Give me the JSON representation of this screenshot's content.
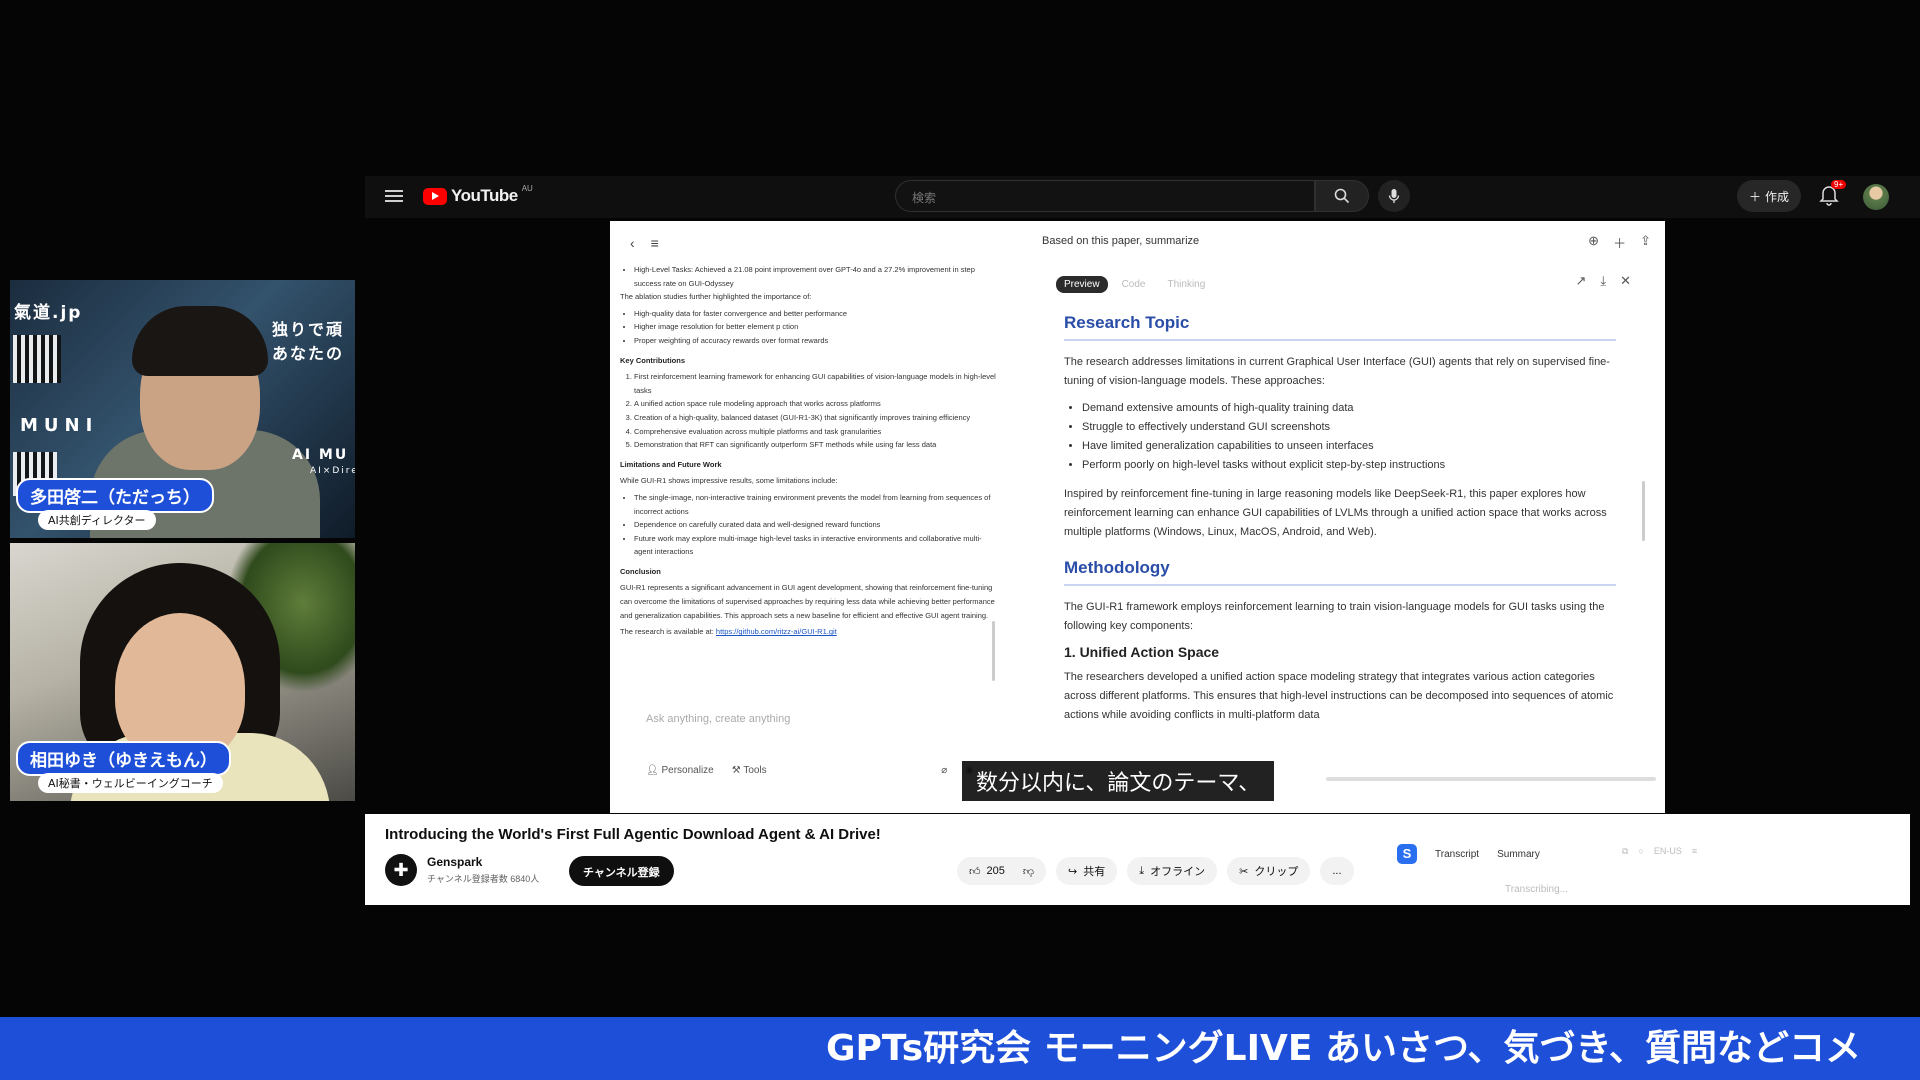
{
  "youtube": {
    "logo_text": "YouTube",
    "region": "AU",
    "search_placeholder": "検索",
    "create_label": "作成",
    "notification_badge": "9+"
  },
  "cams": [
    {
      "name": "多田啓二（ただっち）",
      "role": "AI共創ディレクター",
      "overlay_texts": [
        "氣道.jp",
        "独りで頑",
        "あなたの",
        "MUNI",
        "AI MU",
        "AI×Direct"
      ]
    },
    {
      "name": "相田ゆき（ゆきえもん）",
      "role": "AI秘書・ウェルビーイングコーチ"
    }
  ],
  "left_pane": {
    "intro_items": [
      "High-Level Tasks: Achieved a 21.08 point improvement over GPT-4o and a 27.2% improvement in step success rate on GUI-Odyssey"
    ],
    "ablation_intro": "The ablation studies further highlighted the importance of:",
    "ablation_items": [
      "High-quality data for faster convergence and better performance",
      "Higher image resolution for better element p   ction",
      "Proper weighting of accuracy rewards over format rewards"
    ],
    "contrib_heading": "Key Contributions",
    "contrib_items": [
      "First reinforcement learning framework for enhancing GUI capabilities of vision-language models in high-level tasks",
      "A unified action space rule modeling approach that works across platforms",
      "Creation of a high-quality, balanced dataset (GUI-R1-3K) that significantly improves training efficiency",
      "Comprehensive evaluation across multiple platforms and task granularities",
      "Demonstration that RFT can significantly outperform SFT methods while using far less data"
    ],
    "limits_heading": "Limitations and Future Work",
    "limits_intro": "While GUI-R1 shows impressive results, some limitations include:",
    "limits_items": [
      "The single-image, non-interactive training environment prevents the model from learning from sequences of incorrect actions",
      "Dependence on carefully curated data and well-designed reward functions",
      "Future work may explore multi-image high-level tasks in interactive environments and collaborative multi-agent interactions"
    ],
    "conclusion_heading": "Conclusion",
    "conclusion_text": "GUI-R1 represents a significant advancement in GUI agent development, showing that reinforcement fine-tuning can overcome the limitations of supervised approaches by requiring less data while achieving better performance and generalization capabilities. This approach sets a new baseline for efficient and effective GUI agent training.",
    "available_text": "The research is available at:",
    "link_text": "https://github.com/ritzz-ai/GUI-R1.git",
    "ask_placeholder": "Ask anything, create anything",
    "personalize_label": "Personalize",
    "tools_label": "Tools"
  },
  "right_pane": {
    "header_title": "Based on this paper, summarize",
    "tabs": [
      {
        "label": "Preview",
        "active": true
      },
      {
        "label": "Code",
        "active": false
      },
      {
        "label": "Thinking",
        "active": false
      }
    ],
    "section1_title": "Research Topic",
    "section1_p1": "The research addresses limitations in current Graphical User Interface (GUI) agents that rely on supervised fine-tuning of vision-language models. These approaches:",
    "section1_bullets": [
      "Demand extensive amounts of high-quality training data",
      "Struggle to effectively understand GUI screenshots",
      "Have limited generalization capabilities to unseen interfaces",
      "Perform poorly on high-level tasks without explicit step-by-step instructions"
    ],
    "section1_p2": "Inspired by reinforcement fine-tuning in large reasoning models like DeepSeek-R1, this paper explores how reinforcement learning can enhance GUI capabilities of LVLMs through a unified action space that works across multiple platforms (Windows, Linux, MacOS, Android, and Web).",
    "section2_title": "Methodology",
    "section2_p1": "The GUI-R1 framework employs reinforcement learning to train vision-language models for GUI tasks using the following key components:",
    "subsection_title": "1. Unified Action Space",
    "subsection_p": "The researchers developed a unified action space modeling strategy that integrates various action categories across different platforms. This ensures that high-level instructions can be decomposed into sequences of atomic actions while avoiding conflicts in multi-platform data"
  },
  "subtitle": "数分以内に、論文のテーマ、",
  "video": {
    "title": "Introducing the World's First Full Agentic Download Agent & AI Drive!",
    "channel_name": "Genspark",
    "channel_subs": "チャンネル登録者数 6840人",
    "subscribe_label": "チャンネル登録",
    "likes": "205",
    "share_label": "共有",
    "offline_label": "オフライン",
    "clip_label": "クリップ",
    "more_label": "...",
    "ext_transcript": "Transcript",
    "ext_summary": "Summary",
    "ext_lang": "EN-US",
    "transcribing": "Transcribing..."
  },
  "ticker": "GPTs研究会 モーニングLIVE あいさつ、気づき、質問などコメ"
}
